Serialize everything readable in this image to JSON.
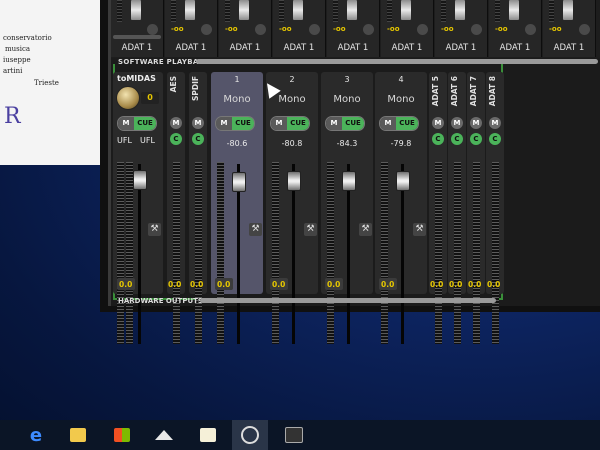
{
  "doc": {
    "lines": [
      "conservatorio",
      "musica",
      "iuseppe",
      "artini",
      "Trieste"
    ],
    "logo": "R"
  },
  "top_strip": {
    "channels": [
      {
        "value": "",
        "label": "ADAT 1"
      },
      {
        "value": "-oo",
        "label": "ADAT 1"
      },
      {
        "value": "-oo",
        "label": "ADAT 1"
      },
      {
        "value": "-oo",
        "label": "ADAT 1"
      },
      {
        "value": "-oo",
        "label": "ADAT 1"
      },
      {
        "value": "-oo",
        "label": "ADAT 1"
      },
      {
        "value": "-oo",
        "label": "ADAT 1"
      },
      {
        "value": "-oo",
        "label": "ADAT 1"
      },
      {
        "value": "-oo",
        "label": "ADAT 1"
      }
    ]
  },
  "sections": {
    "software_playback": "SOFTWARE PLAYBACK",
    "hardware_outputs": "HARDWARE OUTPUTS"
  },
  "tomidas": {
    "name": "toMIDAS",
    "knob_value": "0",
    "left_label": "UFL",
    "right_label": "UFL",
    "fader_value": "0.0"
  },
  "narrow_channels": [
    {
      "label": "AES",
      "m": "M",
      "c": "C",
      "value": "0.0"
    },
    {
      "label": "SPDIF",
      "m": "M",
      "c": "C",
      "value": "0.0"
    }
  ],
  "channels": [
    {
      "num": "1",
      "mode": "Mono",
      "m": "M",
      "cue": "CUE",
      "level": "-80.6",
      "value": "0.0",
      "fader_frac": 0.42
    },
    {
      "num": "2",
      "mode": "Mono",
      "m": "M",
      "cue": "CUE",
      "level": "-80.8",
      "value": "0.0",
      "fader_frac": 0.38
    },
    {
      "num": "3",
      "mode": "Mono",
      "m": "M",
      "cue": "CUE",
      "level": "-84.3",
      "value": "0.0",
      "fader_frac": 0.38
    },
    {
      "num": "4",
      "mode": "Mono",
      "m": "M",
      "cue": "CUE",
      "level": "-79.8",
      "value": "0.0",
      "fader_frac": 0.38
    }
  ],
  "adat_channels": [
    {
      "label": "ADAT 5",
      "m": "M",
      "c": "C",
      "value": "0.0"
    },
    {
      "label": "ADAT 6",
      "m": "M",
      "c": "C",
      "value": "0.0"
    },
    {
      "label": "ADAT 7",
      "m": "M",
      "c": "C",
      "value": "0.0"
    },
    {
      "label": "ADAT 8",
      "m": "M",
      "c": "C",
      "value": "0.0"
    }
  ],
  "taskbar": {
    "icons": [
      "edge-icon",
      "file-explorer-icon",
      "store-icon",
      "mail-icon",
      "music-app-icon",
      "totalmix-icon",
      "terminal-icon"
    ]
  }
}
